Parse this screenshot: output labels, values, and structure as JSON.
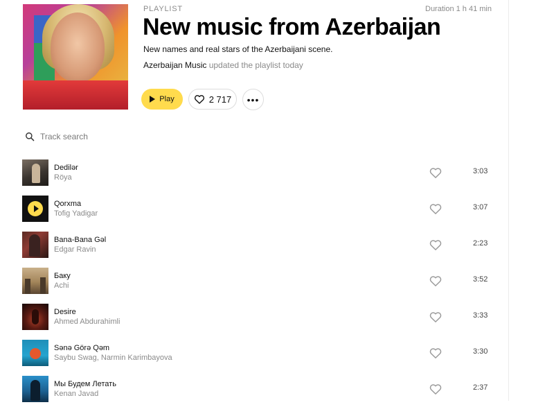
{
  "playlist": {
    "label": "PLAYLIST",
    "duration": "Duration 1 h 41 min",
    "title": "New music from Azerbaijan",
    "description": "New names and real stars of the Azerbaijani scene.",
    "author": "Azerbaijan Music",
    "updated": " updated the playlist today",
    "play_label": "Play",
    "likes": "2 717",
    "more_label": "•••"
  },
  "search": {
    "placeholder": "Track search"
  },
  "tracks": [
    {
      "title": "Dedilər",
      "artist": "Röya",
      "duration": "3:03"
    },
    {
      "title": "Qorxma",
      "artist": "Tofig Yadigar",
      "duration": "3:07"
    },
    {
      "title": "Bana-Bana Gəl",
      "artist": "Edgar Ravin",
      "duration": "2:23"
    },
    {
      "title": "Баку",
      "artist": "Achi",
      "duration": "3:52"
    },
    {
      "title": "Desire",
      "artist": "Ahmed Abdurahimli",
      "duration": "3:33"
    },
    {
      "title": "Sənə Görə Qəm",
      "artist": "Saybu Swag, Narmin Karimbayova",
      "duration": "3:30"
    },
    {
      "title": "Мы Будем Летать",
      "artist": "Kenan Javad",
      "duration": "2:37"
    }
  ],
  "colors": {
    "accent": "#ffdb4d",
    "muted_text": "#8a8a8a"
  }
}
